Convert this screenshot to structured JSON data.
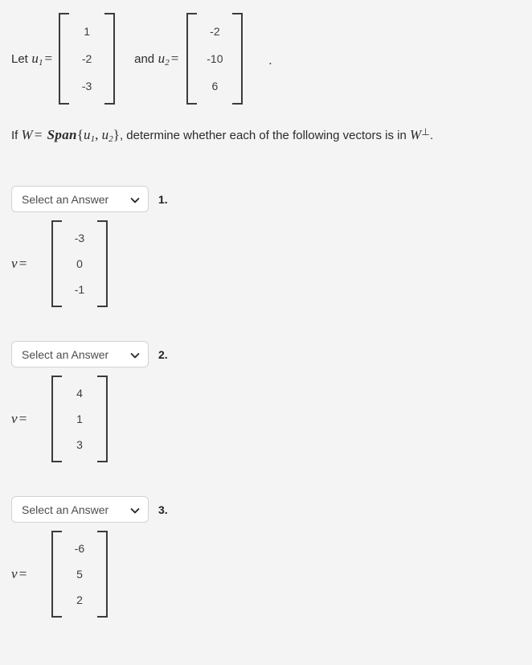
{
  "intro": {
    "lead_text": "Let",
    "u1_name": "u",
    "u1_sub": "1",
    "equals": "=",
    "conjunction": "and",
    "u2_name": "u",
    "u2_sub": "2",
    "trailing_period": ".",
    "u1_vector": [
      "1",
      "-2",
      "-3"
    ],
    "u2_vector": [
      "-2",
      "-10",
      "6"
    ]
  },
  "span_statement": {
    "if_word": "If",
    "w_symbol": "W",
    "equals": "=",
    "span_word": "Span",
    "open_brace": "{",
    "set_u1": "u",
    "set_u1_sub": "1",
    "comma": ",",
    "set_u2": "u",
    "set_u2_sub": "2",
    "close_brace": "}",
    "rest_text": ", determine whether each of the following vectors is in",
    "w_perp_symbol": "W",
    "perp_symbol": "⊥",
    "end_period": "."
  },
  "questions": [
    {
      "select_label": "Select an Answer",
      "chevron_icon": "chevron-down-icon",
      "index_label": "1.",
      "vector_var": "v",
      "vector_equals": "=",
      "vector_values": [
        "-3",
        "0",
        "-1"
      ]
    },
    {
      "select_label": "Select an Answer",
      "chevron_icon": "chevron-down-icon",
      "index_label": "2.",
      "vector_var": "v",
      "vector_equals": "=",
      "vector_values": [
        "4",
        "1",
        "3"
      ]
    },
    {
      "select_label": "Select an Answer",
      "chevron_icon": "chevron-down-icon",
      "index_label": "3.",
      "vector_var": "v",
      "vector_equals": "=",
      "vector_values": [
        "-6",
        "5",
        "2"
      ]
    }
  ],
  "colors": {
    "page_background": "#f4f4f4",
    "text": "#2b2b2b",
    "bracket": "#3b3b3b",
    "select_border": "#d3d3d3",
    "select_background": "#ffffff",
    "select_text": "#4d4d4d"
  }
}
